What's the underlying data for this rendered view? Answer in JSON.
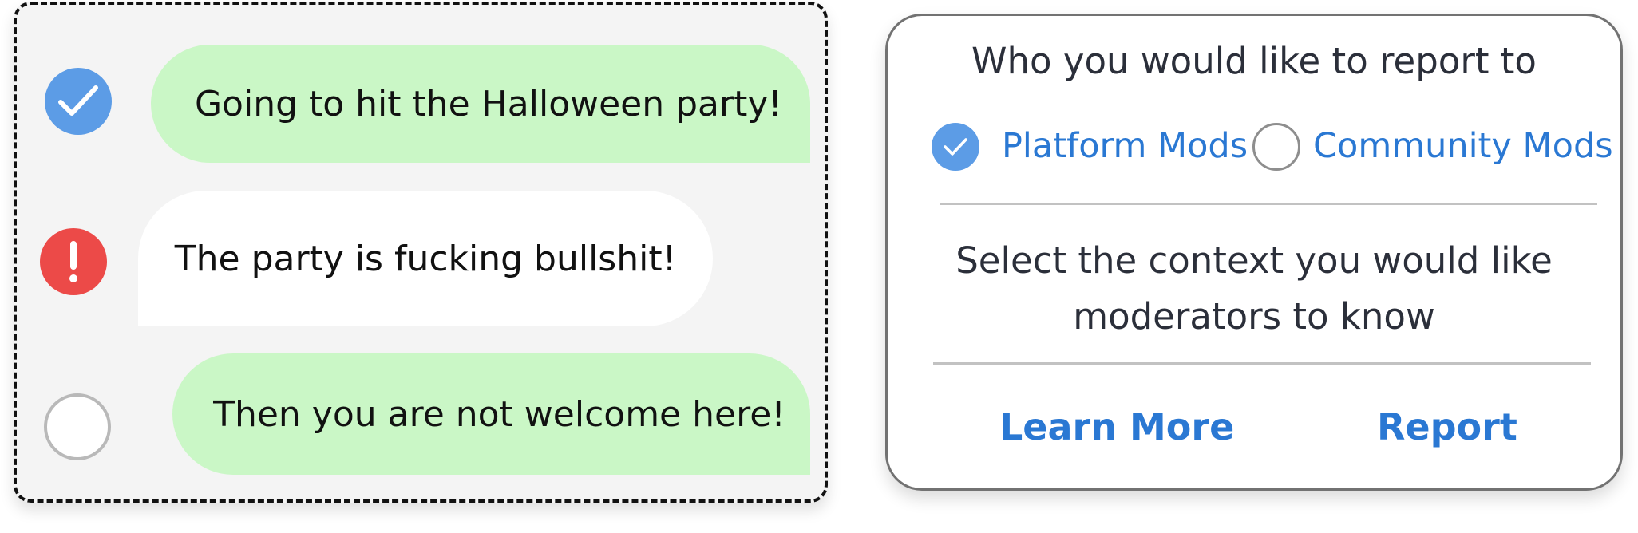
{
  "conversation": {
    "messages": [
      {
        "text": "Going to hit the Halloween party!",
        "status": "checked",
        "status_icon": "check-icon",
        "bubble_color": "#caf7c6",
        "status_color": "#5c9ce6"
      },
      {
        "text": "The party is fucking bullshit!",
        "status": "flagged",
        "status_icon": "exclamation-icon",
        "bubble_color": "#ffffff",
        "status_color": "#ec4a48"
      },
      {
        "text": "Then you are not welcome here!",
        "status": "unchecked",
        "status_icon": "empty-circle-icon",
        "bubble_color": "#caf7c6",
        "status_color": "#ffffff"
      }
    ]
  },
  "report_dialog": {
    "recipient_heading": "Who you would like to report to",
    "options": [
      {
        "label": "Platform Mods",
        "selected": true
      },
      {
        "label": "Community Mods",
        "selected": false
      }
    ],
    "context_heading_line1": "Select the context you would like",
    "context_heading_line2": "moderators to know",
    "learn_more_label": "Learn More",
    "report_label": "Report",
    "accent_color": "#2a78d3",
    "text_color": "#2b2f3a"
  }
}
